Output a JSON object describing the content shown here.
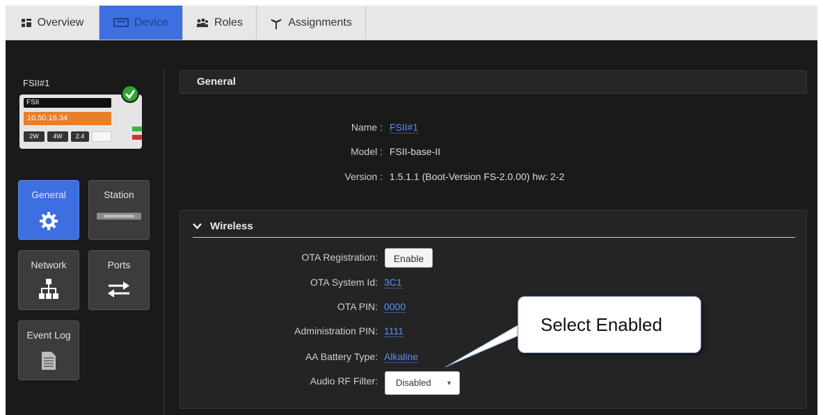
{
  "tabs": [
    {
      "label": "Overview",
      "icon": "grid-icon"
    },
    {
      "label": "Device",
      "icon": "device-icon"
    },
    {
      "label": "Roles",
      "icon": "users-icon"
    },
    {
      "label": "Assignments",
      "icon": "antenna-icon"
    }
  ],
  "active_tab": "Device",
  "device": {
    "name": "FSII#1",
    "model_badge": "FSII",
    "ip": "10.50.16.34",
    "badges": [
      "2W",
      "4W",
      "2.4"
    ],
    "status": "check-icon"
  },
  "nav": {
    "general": "General",
    "station": "Station",
    "network": "Network",
    "ports": "Ports",
    "event_log": "Event Log"
  },
  "general": {
    "title": "General",
    "name_label": "Name :",
    "name_value": "FSII#1",
    "model_label": "Model :",
    "model_value": "FSII-base-II",
    "version_label": "Version :",
    "version_value": "1.5.1.1 (Boot-Version FS-2.0.00) hw: 2-2"
  },
  "wireless": {
    "title": "Wireless",
    "ota_registration_label": "OTA Registration:",
    "ota_registration_button": "Enable",
    "ota_system_id_label": "OTA System Id:",
    "ota_system_id_value": "3C1",
    "ota_pin_label": "OTA PIN:",
    "ota_pin_value": "0000",
    "admin_pin_label": "Administration PIN:",
    "admin_pin_value": "1111",
    "battery_label": "AA Battery Type:",
    "battery_value": "Alkaline",
    "audio_rf_label": "Audio RF Filter:",
    "audio_rf_value": "Disabled"
  },
  "callout": "Select Enabled",
  "colors": {
    "accent": "#3d6fe0",
    "background": "#1a1a1a",
    "link": "#5b8ef0",
    "ip_bar": "#e87d2a"
  }
}
